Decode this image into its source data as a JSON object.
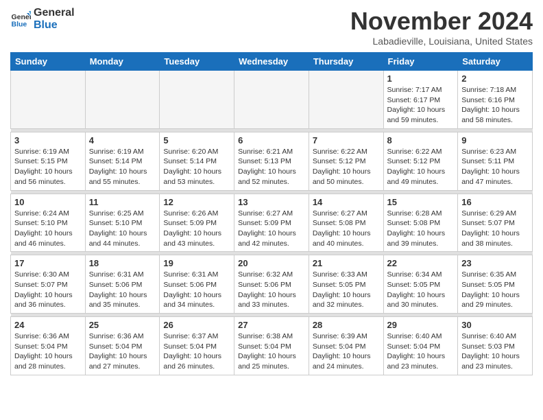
{
  "logo": {
    "line1": "General",
    "line2": "Blue"
  },
  "title": "November 2024",
  "location": "Labadieville, Louisiana, United States",
  "days_of_week": [
    "Sunday",
    "Monday",
    "Tuesday",
    "Wednesday",
    "Thursday",
    "Friday",
    "Saturday"
  ],
  "weeks": [
    {
      "days": [
        {
          "num": "",
          "info": ""
        },
        {
          "num": "",
          "info": ""
        },
        {
          "num": "",
          "info": ""
        },
        {
          "num": "",
          "info": ""
        },
        {
          "num": "",
          "info": ""
        },
        {
          "num": "1",
          "info": "Sunrise: 7:17 AM\nSunset: 6:17 PM\nDaylight: 10 hours\nand 59 minutes."
        },
        {
          "num": "2",
          "info": "Sunrise: 7:18 AM\nSunset: 6:16 PM\nDaylight: 10 hours\nand 58 minutes."
        }
      ]
    },
    {
      "days": [
        {
          "num": "3",
          "info": "Sunrise: 6:19 AM\nSunset: 5:15 PM\nDaylight: 10 hours\nand 56 minutes."
        },
        {
          "num": "4",
          "info": "Sunrise: 6:19 AM\nSunset: 5:14 PM\nDaylight: 10 hours\nand 55 minutes."
        },
        {
          "num": "5",
          "info": "Sunrise: 6:20 AM\nSunset: 5:14 PM\nDaylight: 10 hours\nand 53 minutes."
        },
        {
          "num": "6",
          "info": "Sunrise: 6:21 AM\nSunset: 5:13 PM\nDaylight: 10 hours\nand 52 minutes."
        },
        {
          "num": "7",
          "info": "Sunrise: 6:22 AM\nSunset: 5:12 PM\nDaylight: 10 hours\nand 50 minutes."
        },
        {
          "num": "8",
          "info": "Sunrise: 6:22 AM\nSunset: 5:12 PM\nDaylight: 10 hours\nand 49 minutes."
        },
        {
          "num": "9",
          "info": "Sunrise: 6:23 AM\nSunset: 5:11 PM\nDaylight: 10 hours\nand 47 minutes."
        }
      ]
    },
    {
      "days": [
        {
          "num": "10",
          "info": "Sunrise: 6:24 AM\nSunset: 5:10 PM\nDaylight: 10 hours\nand 46 minutes."
        },
        {
          "num": "11",
          "info": "Sunrise: 6:25 AM\nSunset: 5:10 PM\nDaylight: 10 hours\nand 44 minutes."
        },
        {
          "num": "12",
          "info": "Sunrise: 6:26 AM\nSunset: 5:09 PM\nDaylight: 10 hours\nand 43 minutes."
        },
        {
          "num": "13",
          "info": "Sunrise: 6:27 AM\nSunset: 5:09 PM\nDaylight: 10 hours\nand 42 minutes."
        },
        {
          "num": "14",
          "info": "Sunrise: 6:27 AM\nSunset: 5:08 PM\nDaylight: 10 hours\nand 40 minutes."
        },
        {
          "num": "15",
          "info": "Sunrise: 6:28 AM\nSunset: 5:08 PM\nDaylight: 10 hours\nand 39 minutes."
        },
        {
          "num": "16",
          "info": "Sunrise: 6:29 AM\nSunset: 5:07 PM\nDaylight: 10 hours\nand 38 minutes."
        }
      ]
    },
    {
      "days": [
        {
          "num": "17",
          "info": "Sunrise: 6:30 AM\nSunset: 5:07 PM\nDaylight: 10 hours\nand 36 minutes."
        },
        {
          "num": "18",
          "info": "Sunrise: 6:31 AM\nSunset: 5:06 PM\nDaylight: 10 hours\nand 35 minutes."
        },
        {
          "num": "19",
          "info": "Sunrise: 6:31 AM\nSunset: 5:06 PM\nDaylight: 10 hours\nand 34 minutes."
        },
        {
          "num": "20",
          "info": "Sunrise: 6:32 AM\nSunset: 5:06 PM\nDaylight: 10 hours\nand 33 minutes."
        },
        {
          "num": "21",
          "info": "Sunrise: 6:33 AM\nSunset: 5:05 PM\nDaylight: 10 hours\nand 32 minutes."
        },
        {
          "num": "22",
          "info": "Sunrise: 6:34 AM\nSunset: 5:05 PM\nDaylight: 10 hours\nand 30 minutes."
        },
        {
          "num": "23",
          "info": "Sunrise: 6:35 AM\nSunset: 5:05 PM\nDaylight: 10 hours\nand 29 minutes."
        }
      ]
    },
    {
      "days": [
        {
          "num": "24",
          "info": "Sunrise: 6:36 AM\nSunset: 5:04 PM\nDaylight: 10 hours\nand 28 minutes."
        },
        {
          "num": "25",
          "info": "Sunrise: 6:36 AM\nSunset: 5:04 PM\nDaylight: 10 hours\nand 27 minutes."
        },
        {
          "num": "26",
          "info": "Sunrise: 6:37 AM\nSunset: 5:04 PM\nDaylight: 10 hours\nand 26 minutes."
        },
        {
          "num": "27",
          "info": "Sunrise: 6:38 AM\nSunset: 5:04 PM\nDaylight: 10 hours\nand 25 minutes."
        },
        {
          "num": "28",
          "info": "Sunrise: 6:39 AM\nSunset: 5:04 PM\nDaylight: 10 hours\nand 24 minutes."
        },
        {
          "num": "29",
          "info": "Sunrise: 6:40 AM\nSunset: 5:04 PM\nDaylight: 10 hours\nand 23 minutes."
        },
        {
          "num": "30",
          "info": "Sunrise: 6:40 AM\nSunset: 5:03 PM\nDaylight: 10 hours\nand 23 minutes."
        }
      ]
    }
  ]
}
